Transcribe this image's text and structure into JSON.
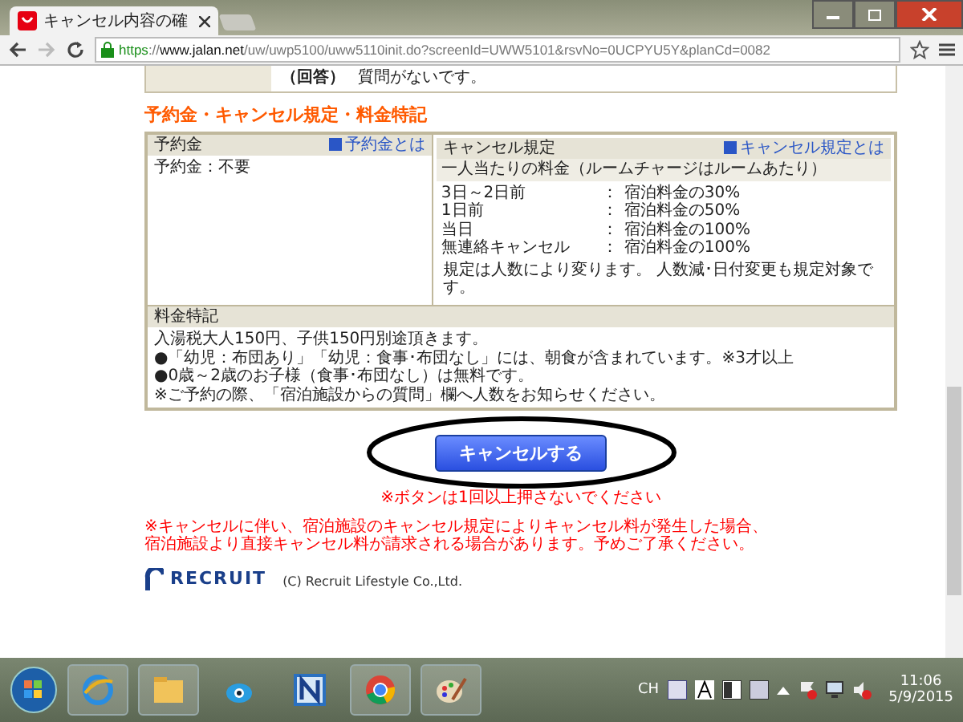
{
  "browser": {
    "tab_title": "キャンセル内容の確",
    "url_scheme": "https",
    "url_sep": "://",
    "url_host": "www.jalan.net",
    "url_path": "/uw/uwp5100/uww5110init.do?screenId=UWW5101&rsvNo=0UCPYU5Y&planCd=0082"
  },
  "qa": {
    "label": "（回答）",
    "text": "質問がないです。"
  },
  "section_title": "予約金・キャンセル規定・料金特記",
  "deposit": {
    "title": "予約金",
    "link": "予約金とは",
    "text": "予約金：不要"
  },
  "cancel_policy": {
    "title": "キャンセル規定",
    "link": "キャンセル規定とは",
    "subtitle": "一人当たりの料金（ルームチャージはルームあたり）",
    "rows": [
      {
        "when": "3日～2日前",
        "sep": "：",
        "fee": "宿泊料金の30%"
      },
      {
        "when": "1日前",
        "sep": "：",
        "fee": "宿泊料金の50%"
      },
      {
        "when": "当日",
        "sep": "：",
        "fee": "宿泊料金の100%"
      },
      {
        "when": "無連絡キャンセル",
        "sep": "：",
        "fee": "宿泊料金の100%"
      }
    ],
    "note": "規定は人数により変ります。 人数減･日付変更も規定対象です。"
  },
  "fees": {
    "title": "料金特記",
    "lines": [
      "入湯税大人150円、子供150円別途頂きます。",
      "●「幼児：布団あり」「幼児：食事･布団なし」には、朝食が含まれています。※3才以上",
      "●0歳～2歳のお子様（食事･布団なし）は無料です。",
      "※ご予約の際、「宿泊施設からの質問」欄へ人数をお知らせください。"
    ]
  },
  "cancel_button": "キャンセルする",
  "button_note": "※ボタンは1回以上押さないでください",
  "warning": [
    "※キャンセルに伴い、宿泊施設のキャンセル規定によりキャンセル料が発生した場合、",
    "宿泊施設より直接キャンセル料が請求される場合があります。予めご了承ください。"
  ],
  "footer": {
    "logo": "RECRUIT",
    "copyright": "(C) Recruit Lifestyle Co.,Ltd."
  },
  "taskbar": {
    "lang": "CH",
    "time": "11:06",
    "date": "5/9/2015"
  }
}
